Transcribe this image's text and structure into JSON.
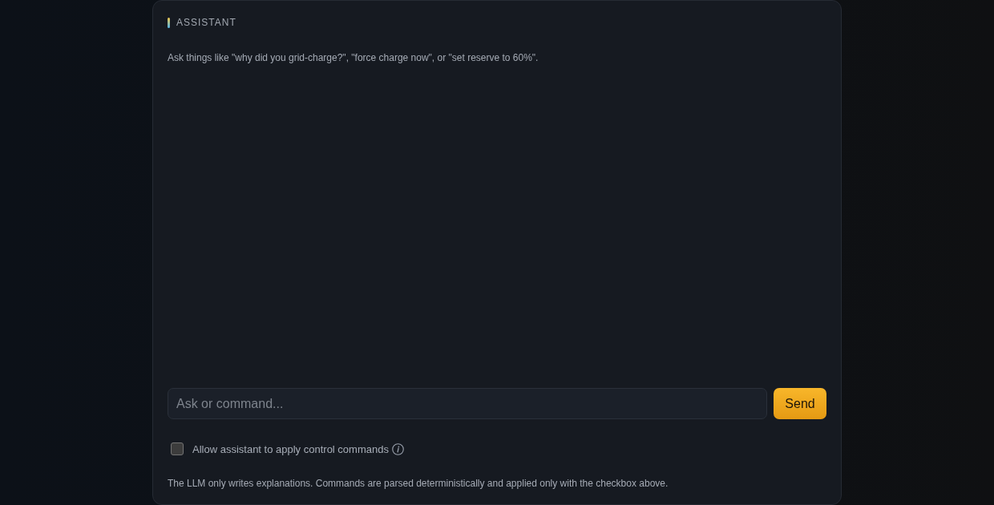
{
  "panel": {
    "title": "ASSISTANT",
    "hint": "Ask things like \"why did you grid-charge?\", \"force charge now\", or \"set reserve to 60%\"."
  },
  "composer": {
    "input": {
      "placeholder": "Ask or command..."
    },
    "send_button": "Send"
  },
  "allow_commands": {
    "label": "Allow assistant to apply control commands",
    "checked": false
  },
  "footer_note": "The LLM only writes explanations. Commands are parsed deterministically and applied only with the checkbox above."
}
